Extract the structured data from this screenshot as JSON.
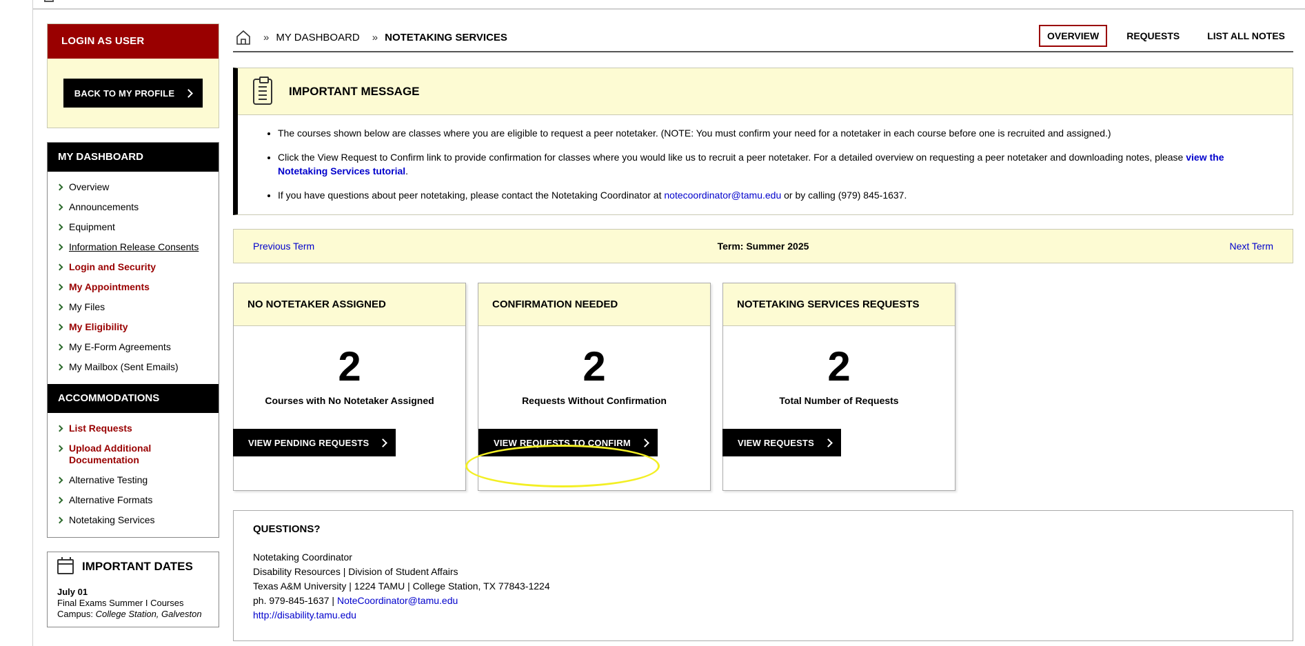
{
  "sidebar": {
    "login_panel": {
      "title": "LOGIN AS USER",
      "back_button": "BACK TO MY PROFILE"
    },
    "dashboard": {
      "title": "MY DASHBOARD",
      "items": [
        {
          "label": "Overview"
        },
        {
          "label": "Announcements"
        },
        {
          "label": "Equipment"
        },
        {
          "label": "Information Release Consents"
        },
        {
          "label": "Login and Security"
        },
        {
          "label": "My Appointments"
        },
        {
          "label": "My Files"
        },
        {
          "label": "My Eligibility"
        },
        {
          "label": "My E-Form Agreements"
        },
        {
          "label": "My Mailbox (Sent Emails)"
        }
      ]
    },
    "accommodations": {
      "title": "ACCOMMODATIONS",
      "items": [
        {
          "label": "List Requests"
        },
        {
          "label": "Upload Additional Documentation"
        },
        {
          "label": "Alternative Testing"
        },
        {
          "label": "Alternative Formats"
        },
        {
          "label": "Notetaking Services"
        }
      ]
    },
    "important_dates": {
      "title": "IMPORTANT DATES",
      "date": "July 01",
      "event": "Final Exams Summer I Courses",
      "campus_prefix": "Campus: ",
      "campus": "College Station, Galveston"
    }
  },
  "breadcrumb": {
    "sep": "»",
    "items": [
      "MY DASHBOARD",
      "NOTETAKING SERVICES"
    ]
  },
  "tabs": [
    {
      "label": "OVERVIEW",
      "active": true
    },
    {
      "label": "REQUESTS"
    },
    {
      "label": "LIST ALL NOTES"
    }
  ],
  "message": {
    "title": "IMPORTANT MESSAGE",
    "bullet1": "The courses shown below are classes where you are eligible to request a peer notetaker. (NOTE: You must confirm your need for a notetaker in each course before one is recruited and assigned.)",
    "bullet2_text": "Click the View Request to Confirm link to provide confirmation for classes where you would like us to recruit a peer notetaker. For a detailed overview on requesting a peer notetaker and downloading notes, please ",
    "bullet2_link": "view the Notetaking Services tutorial",
    "bullet2_end": ".",
    "bullet3_text": "If you have questions about peer notetaking, please contact the Notetaking Coordinator at ",
    "bullet3_email": "notecoordinator@tamu.edu",
    "bullet3_end": " or by calling (979) 845-1637."
  },
  "term": {
    "prev": "Previous Term",
    "current": "Term: Summer 2025",
    "next": "Next Term"
  },
  "cards": [
    {
      "title": "NO NOTETAKER ASSIGNED",
      "count": "2",
      "label": "Courses with No Notetaker Assigned",
      "button": "VIEW PENDING REQUESTS"
    },
    {
      "title": "CONFIRMATION NEEDED",
      "count": "2",
      "label": "Requests Without Confirmation",
      "button": "VIEW REQUESTS TO CONFIRM"
    },
    {
      "title": "NOTETAKING SERVICES REQUESTS",
      "count": "2",
      "label": "Total Number of Requests",
      "button": "VIEW REQUESTS"
    }
  ],
  "questions": {
    "title": "QUESTIONS?",
    "line1": "Notetaking Coordinator",
    "line2": "Disability Resources | Division of Student Affairs",
    "line3": "Texas A&M University | 1224 TAMU | College Station, TX 77843-1224",
    "phone": "ph. 979-845-1637 | ",
    "email": "NoteCoordinator@tamu.edu",
    "website": "http://disability.tamu.edu"
  },
  "colors": {
    "brand_red": "#990000",
    "panel_yellow": "#fdfbd3",
    "link_blue": "#0000cc",
    "highlight": "#f3ef24"
  }
}
